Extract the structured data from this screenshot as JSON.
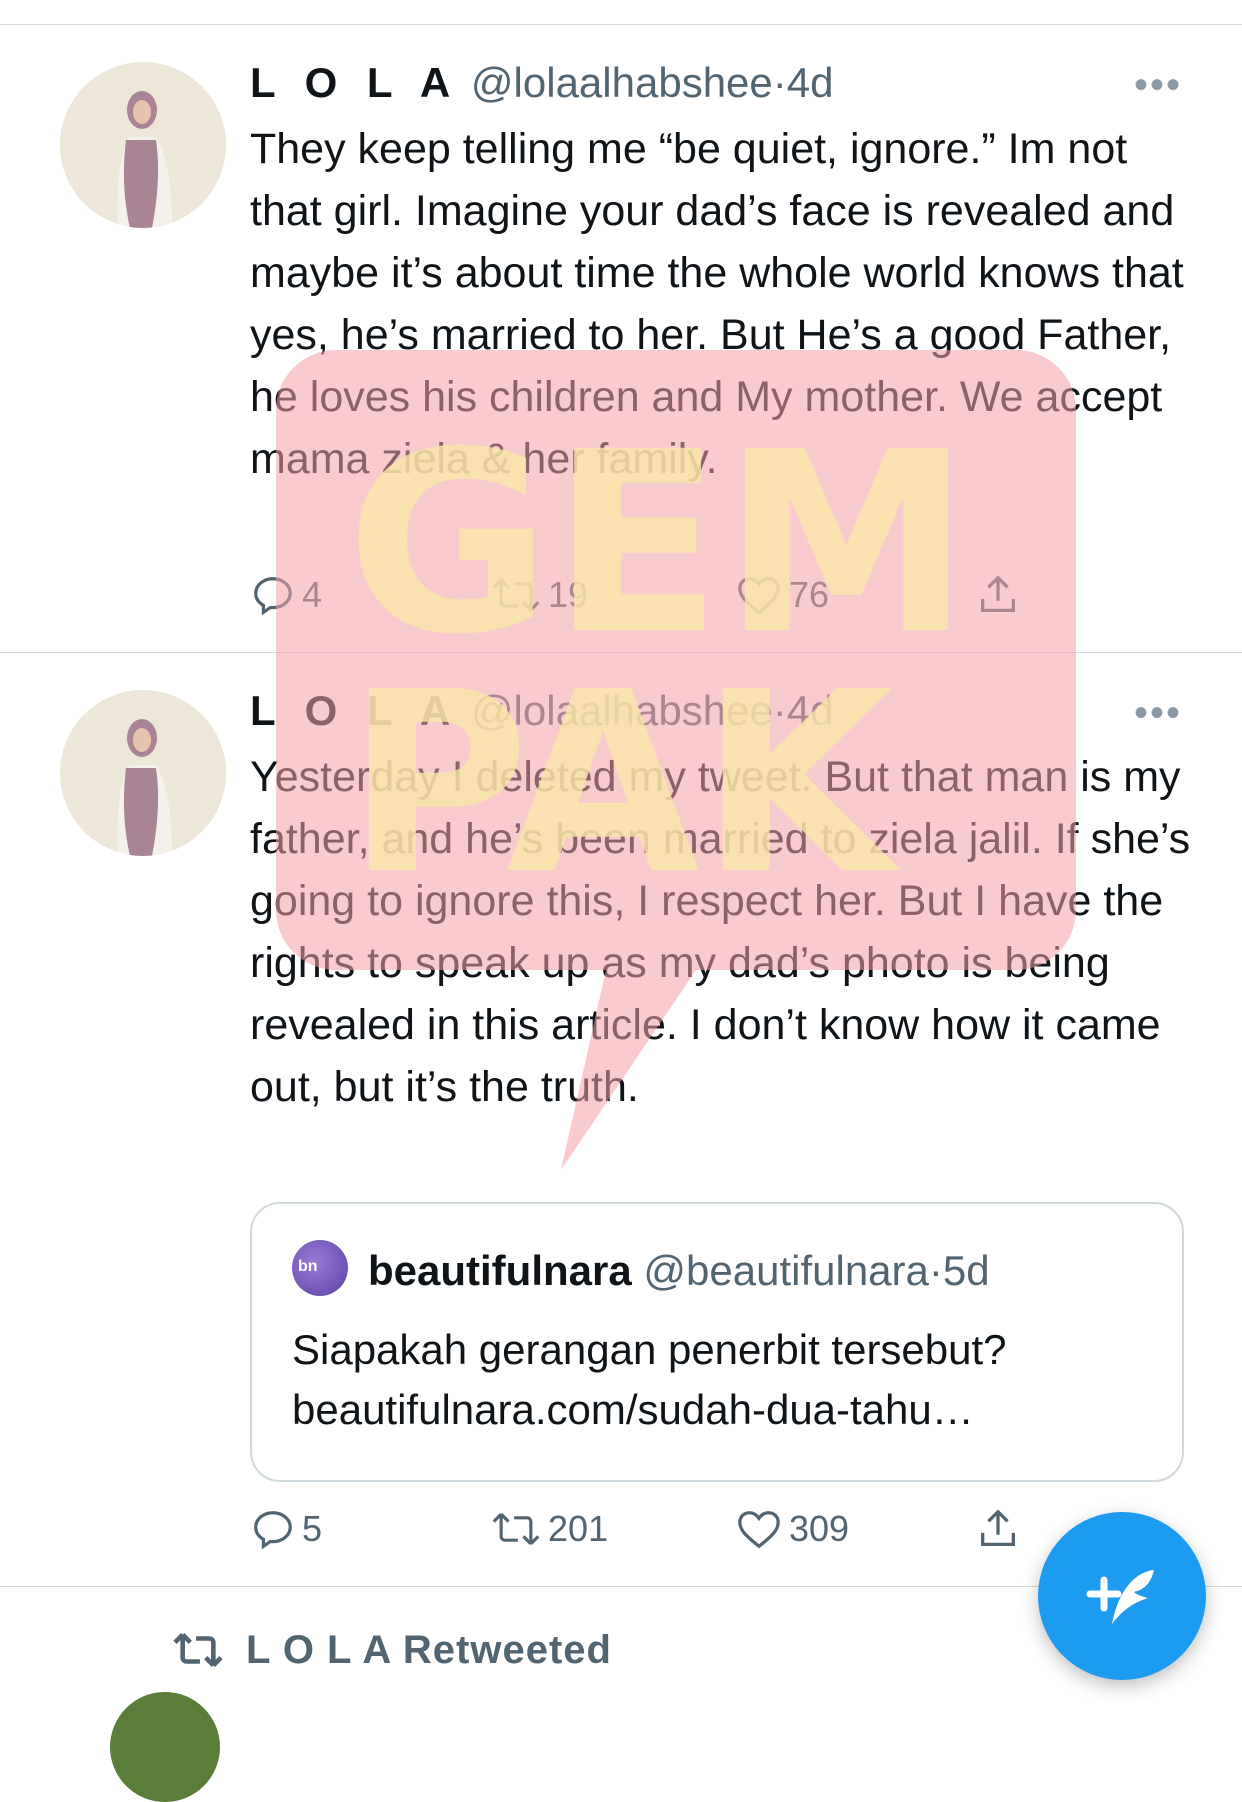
{
  "tweets": [
    {
      "name": "L O L A",
      "handle": "@lolaalhabshee",
      "dot": "·",
      "time": "4d",
      "more": "•••",
      "text": "They keep telling me “be quiet, ignore.” Im not that girl. Imagine your dad’s face is revealed and maybe it’s about time the whole world knows that yes, he’s married to her. But He’s a good Father, he loves his children and My mother. We accept mama ziela & her family.",
      "replies": "4",
      "retweets": "19",
      "likes": "76"
    },
    {
      "name": "L O L A",
      "handle": "@lolaalhabshee",
      "dot": "·",
      "time": "4d",
      "more": "•••",
      "text": "Yesterday I deleted my tweet. But that man is my father, and he’s been married to ziela jalil. If she’s going to ignore this, I respect her. But I have the rights to speak up as my dad’s photo is being revealed in this article. I don’t know how it came out, but it’s the truth.",
      "replies": "5",
      "retweets": "201",
      "likes": "309",
      "quote": {
        "avatar_text": "bn",
        "name": "beautifulnara",
        "handle": "@beautifulnara",
        "dot": "·",
        "time": "5d",
        "text_line1": "Siapakah gerangan penerbit tersebut?",
        "text_line2": "beautifulnara.com/sudah-dua-tahu…"
      }
    }
  ],
  "retweeted_label": "L O L A Retweeted",
  "watermark": {
    "line1": "GEM",
    "line2": "PAK",
    "bubble_color": "#f4a1a8",
    "text_color": "#f9e8a8"
  },
  "colors": {
    "accent": "#1d9bf0",
    "secondary_text": "#536471",
    "divider": "#cfd9de"
  },
  "icons": [
    "reply-icon",
    "retweet-icon",
    "like-icon",
    "share-icon",
    "more-icon",
    "compose-icon"
  ]
}
